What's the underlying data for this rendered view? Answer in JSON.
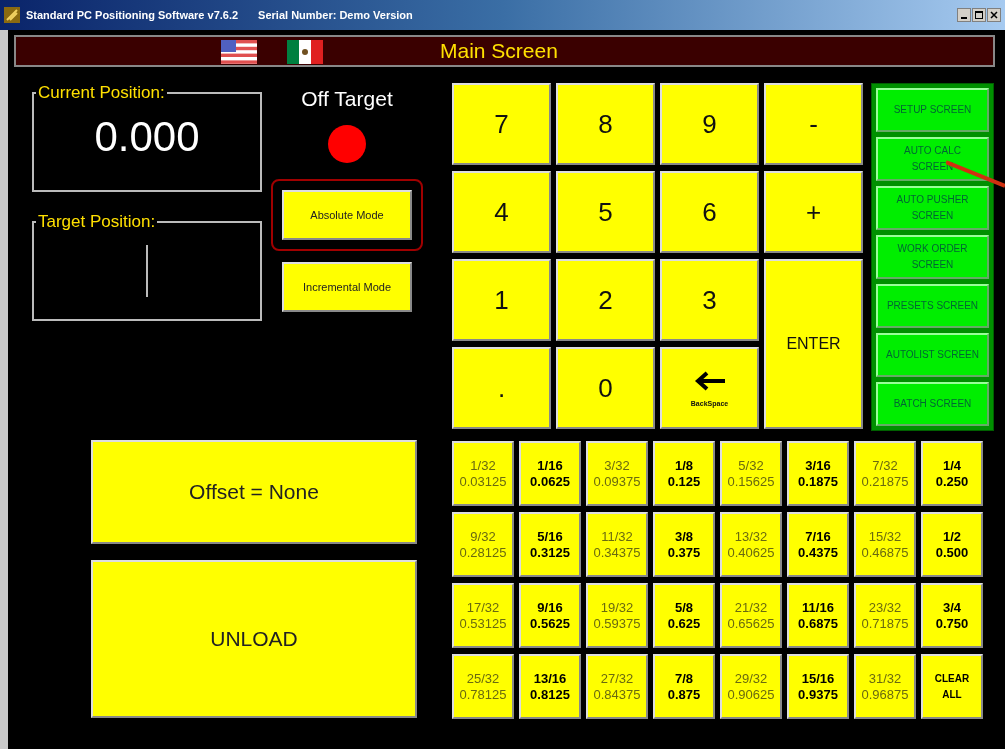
{
  "window": {
    "title": "Standard PC Positioning Software v7.6.2",
    "serial": "Serial Number: Demo Version"
  },
  "header": {
    "title": "Main Screen"
  },
  "current_position": {
    "label": "Current Position:",
    "value": "0.000"
  },
  "target_position": {
    "label": "Target Position:"
  },
  "status": {
    "label": "Off Target",
    "color": "#ff0000"
  },
  "modes": [
    {
      "label": "Absolute Mode",
      "selected": true
    },
    {
      "label": "Incremental Mode",
      "selected": false
    }
  ],
  "keypad": [
    {
      "kind": "digit",
      "label": "7"
    },
    {
      "kind": "digit",
      "label": "8"
    },
    {
      "kind": "digit",
      "label": "9"
    },
    {
      "kind": "digit",
      "label": "-"
    },
    {
      "kind": "digit",
      "label": "4"
    },
    {
      "kind": "digit",
      "label": "5"
    },
    {
      "kind": "digit",
      "label": "6"
    },
    {
      "kind": "digit",
      "label": "+"
    },
    {
      "kind": "digit",
      "label": "1"
    },
    {
      "kind": "digit",
      "label": "2"
    },
    {
      "kind": "digit",
      "label": "3"
    },
    {
      "kind": "enter",
      "label": "ENTER"
    },
    {
      "kind": "digit",
      "label": "."
    },
    {
      "kind": "digit",
      "label": "0"
    },
    {
      "kind": "backspace",
      "label": "BackSpace"
    }
  ],
  "screen_buttons": [
    {
      "label": "SETUP SCREEN"
    },
    {
      "label": "AUTO CALC SCREEN"
    },
    {
      "label": "AUTO PUSHER SCREEN"
    },
    {
      "label": "WORK ORDER SCREEN"
    },
    {
      "label": "PRESETS SCREEN"
    },
    {
      "label": "AUTOLIST SCREEN"
    },
    {
      "label": "BATCH SCREEN"
    }
  ],
  "offset_button": "Offset = None",
  "unload_button": "UNLOAD",
  "fractions": [
    {
      "kind": "fine",
      "fraction": "1/32",
      "decimal": "0.03125"
    },
    {
      "kind": "major",
      "fraction": "1/16",
      "decimal": "0.0625"
    },
    {
      "kind": "fine",
      "fraction": "3/32",
      "decimal": "0.09375"
    },
    {
      "kind": "major",
      "fraction": "1/8",
      "decimal": "0.125"
    },
    {
      "kind": "fine",
      "fraction": "5/32",
      "decimal": "0.15625"
    },
    {
      "kind": "major",
      "fraction": "3/16",
      "decimal": "0.1875"
    },
    {
      "kind": "fine",
      "fraction": "7/32",
      "decimal": "0.21875"
    },
    {
      "kind": "major",
      "fraction": "1/4",
      "decimal": "0.250"
    },
    {
      "kind": "fine",
      "fraction": "9/32",
      "decimal": "0.28125"
    },
    {
      "kind": "major",
      "fraction": "5/16",
      "decimal": "0.3125"
    },
    {
      "kind": "fine",
      "fraction": "11/32",
      "decimal": "0.34375"
    },
    {
      "kind": "major",
      "fraction": "3/8",
      "decimal": "0.375"
    },
    {
      "kind": "fine",
      "fraction": "13/32",
      "decimal": "0.40625"
    },
    {
      "kind": "major",
      "fraction": "7/16",
      "decimal": "0.4375"
    },
    {
      "kind": "fine",
      "fraction": "15/32",
      "decimal": "0.46875"
    },
    {
      "kind": "major",
      "fraction": "1/2",
      "decimal": "0.500"
    },
    {
      "kind": "fine",
      "fraction": "17/32",
      "decimal": "0.53125"
    },
    {
      "kind": "major",
      "fraction": "9/16",
      "decimal": "0.5625"
    },
    {
      "kind": "fine",
      "fraction": "19/32",
      "decimal": "0.59375"
    },
    {
      "kind": "major",
      "fraction": "5/8",
      "decimal": "0.625"
    },
    {
      "kind": "fine",
      "fraction": "21/32",
      "decimal": "0.65625"
    },
    {
      "kind": "major",
      "fraction": "11/16",
      "decimal": "0.6875"
    },
    {
      "kind": "fine",
      "fraction": "23/32",
      "decimal": "0.71875"
    },
    {
      "kind": "major",
      "fraction": "3/4",
      "decimal": "0.750"
    },
    {
      "kind": "fine",
      "fraction": "25/32",
      "decimal": "0.78125"
    },
    {
      "kind": "major",
      "fraction": "13/16",
      "decimal": "0.8125"
    },
    {
      "kind": "fine",
      "fraction": "27/32",
      "decimal": "0.84375"
    },
    {
      "kind": "major",
      "fraction": "7/8",
      "decimal": "0.875"
    },
    {
      "kind": "fine",
      "fraction": "29/32",
      "decimal": "0.90625"
    },
    {
      "kind": "major",
      "fraction": "15/16",
      "decimal": "0.9375"
    },
    {
      "kind": "fine",
      "fraction": "31/32",
      "decimal": "0.96875"
    },
    {
      "kind": "clear",
      "fraction": "CLEAR ALL"
    }
  ]
}
